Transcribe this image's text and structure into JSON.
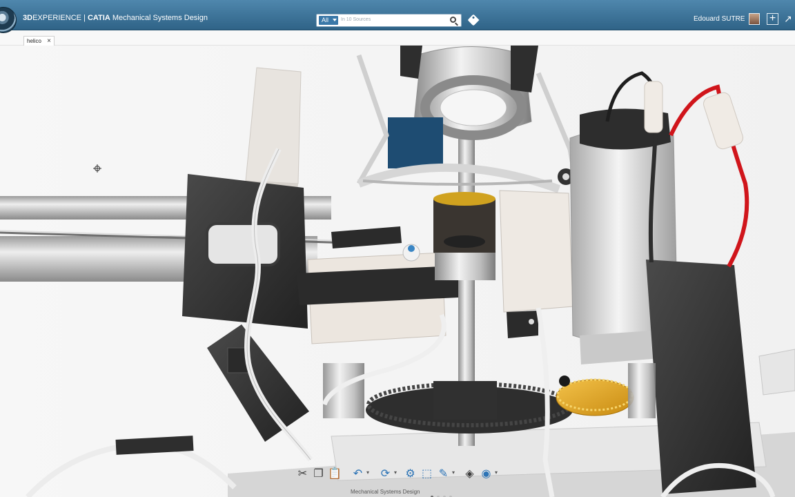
{
  "app": {
    "brand_bold": "3D",
    "brand_rest": "EXPERIENCE",
    "brand_sep": " | ",
    "brand_catia": "CATIA",
    "brand_app": " Mechanical Systems Design"
  },
  "search": {
    "scope": "All",
    "placeholder": "In 10 Sources"
  },
  "user": {
    "name": "Edouard SUTRE"
  },
  "tabs": [
    {
      "label": "helico",
      "close": "×"
    }
  ],
  "toolbar": {
    "items": [
      {
        "icon": "scissors-icon",
        "glyph": "✂"
      },
      {
        "icon": "copy-icon",
        "glyph": "❐"
      },
      {
        "icon": "paste-icon",
        "glyph": "📋"
      },
      {
        "icon": "undo-icon",
        "glyph": "↶"
      },
      {
        "icon": "update-icon",
        "glyph": "⟳"
      },
      {
        "icon": "assembly-icon",
        "glyph": "⚙"
      },
      {
        "icon": "measure-icon",
        "glyph": "⬚"
      },
      {
        "icon": "sketch-icon",
        "glyph": "✎"
      },
      {
        "icon": "view-icon",
        "glyph": "◈"
      },
      {
        "icon": "render-icon",
        "glyph": "◉"
      }
    ],
    "caption": "Mechanical Systems Design"
  },
  "colors": {
    "topbar": "#2f6387",
    "accent": "#3a78a8",
    "wire_red": "#d0151b",
    "gear_gold": "#e3a21a"
  }
}
